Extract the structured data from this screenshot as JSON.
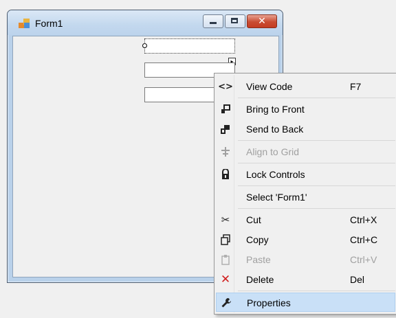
{
  "window": {
    "title": "Form1",
    "icon": "form-app-icon",
    "caption_buttons": [
      "minimize",
      "maximize",
      "close"
    ],
    "close_glyph": "✕"
  },
  "designer": {
    "textboxes": [
      "textBox1",
      "textBox2",
      "textBox3"
    ],
    "smart_tag_glyph": "▸"
  },
  "context_menu": {
    "items": [
      {
        "label": "View Code",
        "shortcut": "F7",
        "icon": "code-icon",
        "glyph": "<>",
        "enabled": true
      },
      {
        "label": "Bring to Front",
        "shortcut": "",
        "icon": "bring-to-front-icon",
        "glyph": "⮺",
        "enabled": true
      },
      {
        "label": "Send to Back",
        "shortcut": "",
        "icon": "send-to-back-icon",
        "glyph": "⮺",
        "enabled": true
      },
      {
        "label": "Align to Grid",
        "shortcut": "",
        "icon": "align-grid-icon",
        "glyph": "╪",
        "enabled": false
      },
      {
        "label": "Lock Controls",
        "shortcut": "",
        "icon": "lock-icon",
        "glyph": "🔒",
        "enabled": true
      },
      {
        "label": "Select 'Form1'",
        "shortcut": "",
        "icon": "",
        "glyph": "",
        "enabled": true
      },
      {
        "label": "Cut",
        "shortcut": "Ctrl+X",
        "icon": "scissors-icon",
        "glyph": "✂",
        "enabled": true
      },
      {
        "label": "Copy",
        "shortcut": "Ctrl+C",
        "icon": "copy-icon",
        "glyph": "⧉",
        "enabled": true
      },
      {
        "label": "Paste",
        "shortcut": "Ctrl+V",
        "icon": "paste-icon",
        "glyph": "📋",
        "enabled": false
      },
      {
        "label": "Delete",
        "shortcut": "Del",
        "icon": "delete-icon",
        "glyph": "✕",
        "enabled": true
      },
      {
        "label": "Properties",
        "shortcut": "",
        "icon": "wrench-icon",
        "glyph": "🔧",
        "enabled": true,
        "highlighted": true
      }
    ]
  },
  "colors": {
    "window_frame": "#b9d1ea",
    "menu_highlight": "#c9e0f7",
    "delete_icon": "#d02020",
    "disabled_text": "#a0a0a0"
  }
}
